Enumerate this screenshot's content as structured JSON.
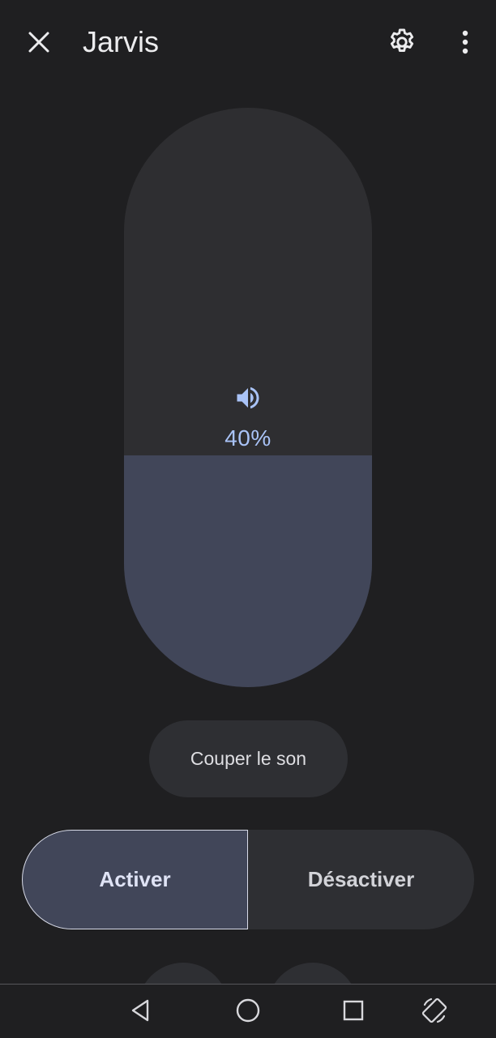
{
  "header": {
    "title": "Jarvis",
    "close_icon": "close-icon",
    "settings_icon": "gear-icon",
    "more_icon": "more-vert-icon"
  },
  "volume": {
    "level_percent": 40,
    "label": "40%",
    "icon": "speaker-volume-icon",
    "fill_color": "#414659",
    "track_color": "#2e2e31",
    "accent_color": "#a9c3f7"
  },
  "mute": {
    "label": "Couper le son"
  },
  "power": {
    "on_label": "Activer",
    "off_label": "Désactiver",
    "selected": "on"
  },
  "navbar": {
    "back_icon": "back-triangle-icon",
    "home_icon": "home-circle-icon",
    "recents_icon": "recents-square-icon",
    "rotate_icon": "screen-rotate-icon"
  }
}
